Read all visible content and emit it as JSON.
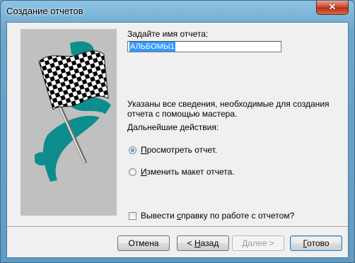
{
  "window": {
    "title": "Создание отчетов",
    "close_glyph": "✕"
  },
  "form": {
    "name_label": "Задайте имя отчета:",
    "name_value": "АЛЬБОМЫ1",
    "info_line1": "Указаны все сведения, необходимые для создания",
    "info_line2": "отчета с помощью мастера.",
    "next_actions_label": "Дальнейшие действия:",
    "radio_preview": {
      "key": "П",
      "rest": "росмотреть отчет.",
      "checked": true
    },
    "radio_modify": {
      "key": "И",
      "rest": "зменить макет отчета.",
      "checked": false
    },
    "help_checkbox": {
      "pre": "Вывести ",
      "key": "с",
      "rest": "правку по работе с отчетом?",
      "checked": false
    }
  },
  "buttons": {
    "cancel": "Отмена",
    "back_pre": "< ",
    "back_key": "Н",
    "back_rest": "азад",
    "next_pre": "",
    "next_key": "Д",
    "next_rest": "алее >",
    "finish_key": "Г",
    "finish_rest": "отово"
  },
  "icons": {
    "picture": "checkered-flag-icon"
  },
  "colors": {
    "accent_teal": "#0e8d8d",
    "selection": "#3399ff"
  }
}
